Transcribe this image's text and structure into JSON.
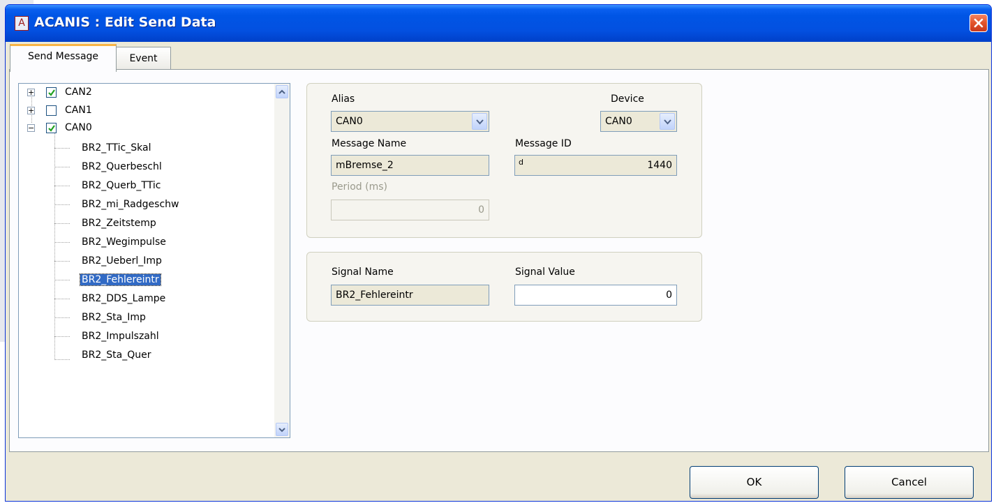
{
  "window": {
    "app_icon_letter": "A",
    "title": "ACANIS : Edit Send Data"
  },
  "tabs": [
    {
      "label": "Send Message",
      "active": true
    },
    {
      "label": "Event",
      "active": false
    }
  ],
  "tree": {
    "roots": [
      {
        "label": "CAN2",
        "checked": true,
        "expanded": false
      },
      {
        "label": "CAN1",
        "checked": false,
        "expanded": false
      },
      {
        "label": "CAN0",
        "checked": true,
        "expanded": true
      }
    ],
    "children": [
      "BR2_TTic_Skal",
      "BR2_Querbeschl",
      "BR2_Querb_TTic",
      "BR2_mi_Radgeschw",
      "BR2_Zeitstemp",
      "BR2_Wegimpulse",
      "BR2_Ueberl_Imp",
      "BR2_Fehlereintr",
      "BR2_DDS_Lampe",
      "BR2_Sta_Imp",
      "BR2_Impulszahl",
      "BR2_Sta_Quer"
    ],
    "selected": "BR2_Fehlereintr"
  },
  "message": {
    "alias_label": "Alias",
    "alias_value": "CAN0",
    "device_label": "Device",
    "device_value": "CAN0",
    "name_label": "Message Name",
    "name_value": "mBremse_2",
    "id_label": "Message ID",
    "id_prefix": "d",
    "id_value": "1440",
    "period_label": "Period (ms)",
    "period_value": "0"
  },
  "signal": {
    "name_label": "Signal Name",
    "name_value": "BR2_Fehlereintr",
    "value_label": "Signal Value",
    "value_value": "0"
  },
  "buttons": {
    "ok": "OK",
    "cancel": "Cancel"
  },
  "colors": {
    "titlebar": "#0055e5",
    "selection": "#316ac5",
    "dialog_bg": "#ece9d8"
  }
}
